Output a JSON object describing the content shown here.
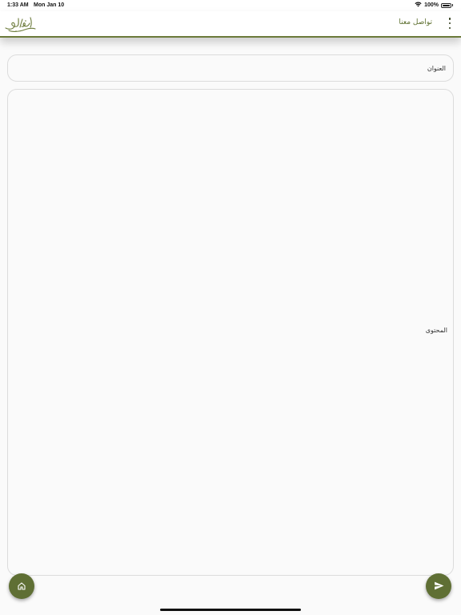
{
  "status_bar": {
    "time": "1:33 AM",
    "date": "Mon Jan 10",
    "battery": "100%",
    "wifi_icon": "wifi-icon",
    "battery_icon": "battery-icon"
  },
  "app_bar": {
    "title": "تواصل معنا",
    "logo_icon": "calligraphy-logo-icon",
    "menu_icon": "more-vert-icon",
    "accent_color": "#6b7a3a"
  },
  "form": {
    "title_placeholder": "العنوان",
    "content_placeholder": "المحتوى"
  },
  "fabs": {
    "home_icon": "home-icon",
    "send_icon": "send-icon",
    "color": "#5f6f34"
  }
}
